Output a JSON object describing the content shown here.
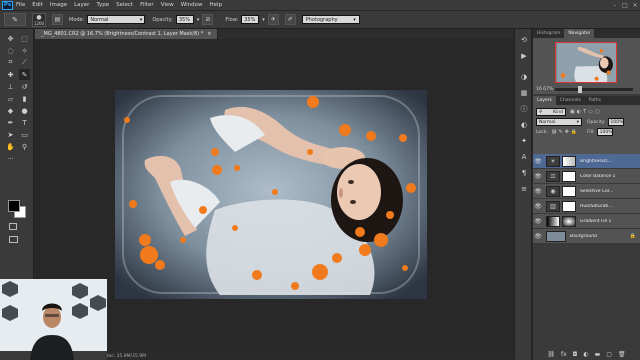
{
  "app": {
    "logo": "Ps"
  },
  "menu": [
    "File",
    "Edit",
    "Image",
    "Layer",
    "Type",
    "Select",
    "Filter",
    "View",
    "Window",
    "Help"
  ],
  "window_controls": [
    "-",
    "□",
    "×"
  ],
  "options": {
    "brush_size": "1200",
    "mode_label": "Mode:",
    "mode_value": "Normal",
    "opacity_label": "Opacity:",
    "opacity_value": "35%",
    "flow_label": "Flow:",
    "flow_value": "35%",
    "workspace": "Photography"
  },
  "document": {
    "tab_title": "_MG_4801.CR2 @ 16.7% (Brightness/Contrast 1, Layer Mask/8) *",
    "tab_close": "×",
    "status": "Doc: 35.9M/35.9M"
  },
  "panels": {
    "top_tabs": [
      "Histogram",
      "Navigator"
    ],
    "zoom": "16.67%",
    "layer_tabs": [
      "Layers",
      "Channels",
      "Paths"
    ],
    "kind_label": "Kind",
    "blend_mode": "Normal",
    "opacity_label": "Opacity:",
    "opacity_value": "100%",
    "lock_label": "Lock:",
    "fill_label": "Fill:",
    "fill_value": "100%",
    "layers": [
      {
        "name": "Brightness/C...",
        "icon": "brightness-icon",
        "mask": true,
        "selected": true
      },
      {
        "name": "Color Balance 1",
        "icon": "balance-icon",
        "mask": true,
        "selected": false
      },
      {
        "name": "Selective Col...",
        "icon": "selective-icon",
        "mask": true,
        "selected": false
      },
      {
        "name": "Hue/Saturati...",
        "icon": "hue-icon",
        "mask": true,
        "selected": false
      },
      {
        "name": "Gradient Fill 1",
        "icon": "gradient-icon",
        "mask": true,
        "selected": false
      },
      {
        "name": "Background",
        "icon": "photo-icon",
        "mask": false,
        "selected": false
      }
    ]
  },
  "colors": {
    "accent": "#31a8ff",
    "selected_layer": "#4e6a94",
    "petal": "#f07a1c"
  }
}
